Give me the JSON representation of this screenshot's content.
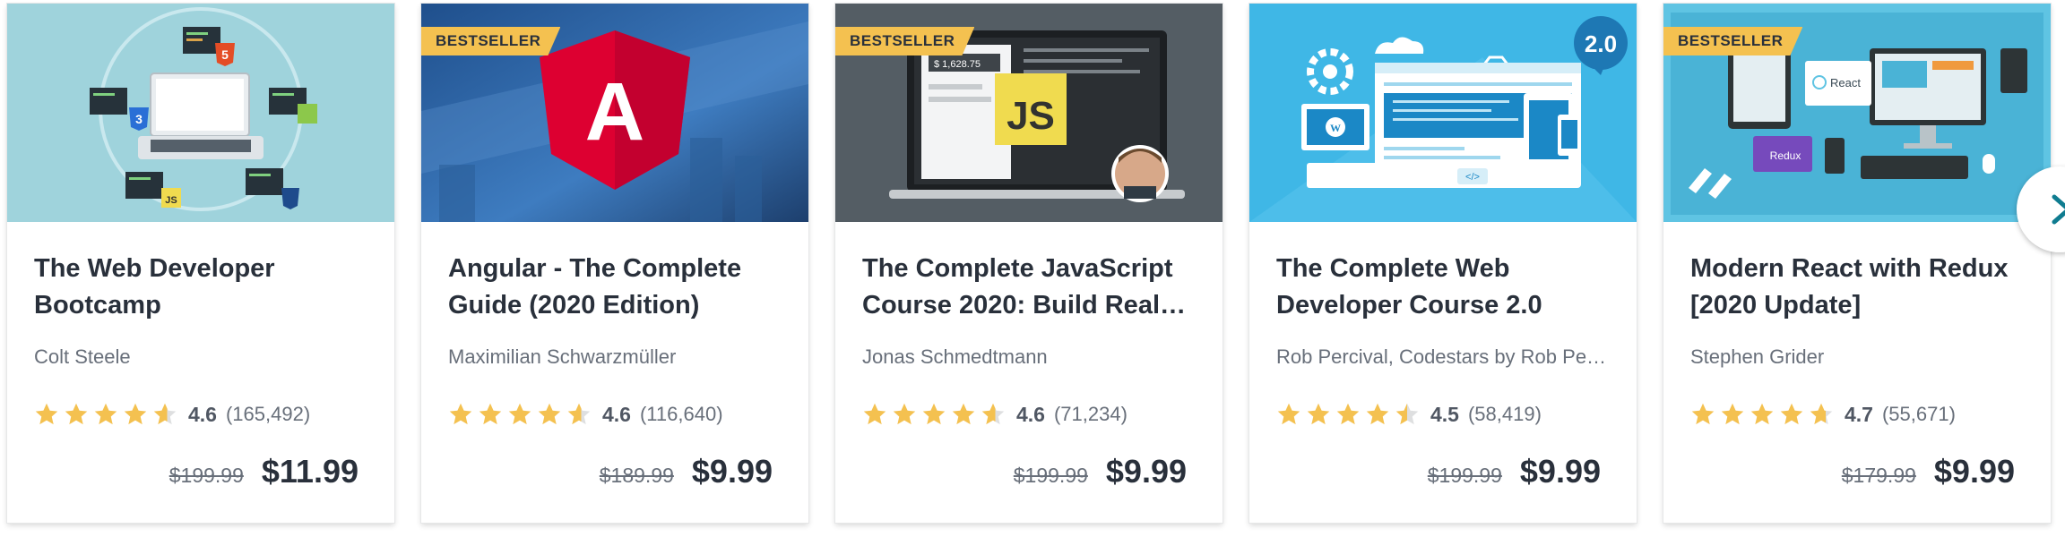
{
  "courses": [
    {
      "title": "The Web Developer Bootcamp",
      "author": "Colt Steele",
      "rating": "4.6",
      "rating_value": 4.6,
      "reviews": "(165,492)",
      "original_price": "$199.99",
      "sale_price": "$11.99",
      "badge": ""
    },
    {
      "title": "Angular - The Complete Guide (2020 Edition)",
      "author": "Maximilian Schwarzmüller",
      "rating": "4.6",
      "rating_value": 4.6,
      "reviews": "(116,640)",
      "original_price": "$189.99",
      "sale_price": "$9.99",
      "badge": "BESTSELLER"
    },
    {
      "title": "The Complete JavaScript Course 2020: Build Real…",
      "author": "Jonas Schmedtmann",
      "rating": "4.6",
      "rating_value": 4.6,
      "reviews": "(71,234)",
      "original_price": "$199.99",
      "sale_price": "$9.99",
      "badge": "BESTSELLER"
    },
    {
      "title": "The Complete Web Developer Course 2.0",
      "author": "Rob Percival, Codestars by Rob Pe…",
      "rating": "4.5",
      "rating_value": 4.5,
      "reviews": "(58,419)",
      "original_price": "$199.99",
      "sale_price": "$9.99",
      "badge": ""
    },
    {
      "title": "Modern React with Redux [2020 Update]",
      "author": "Stephen Grider",
      "rating": "4.7",
      "rating_value": 4.7,
      "reviews": "(55,671)",
      "original_price": "$179.99",
      "sale_price": "$9.99",
      "badge": "BESTSELLER"
    }
  ],
  "thumbnails": {
    "t1": {
      "html5": "5",
      "css3": "3",
      "js": "JS"
    },
    "t2": {
      "logo": "A"
    },
    "t3": {
      "js": "JS",
      "screen_value": "$ 1,628.75"
    },
    "t4": {
      "version": "2.0",
      "wp": "W",
      "code": "</>"
    },
    "t5": {
      "react": "React",
      "redux": "Redux"
    }
  },
  "colors": {
    "accent_star": "#f4c150",
    "badge_bg": "#f4c150",
    "text_dark": "#29303b",
    "text_muted": "#686f7a",
    "star_empty": "#dedfe0",
    "chevron": "#0f7c90"
  },
  "icons": {
    "star": "star-icon",
    "next": "chevron-right-icon"
  }
}
